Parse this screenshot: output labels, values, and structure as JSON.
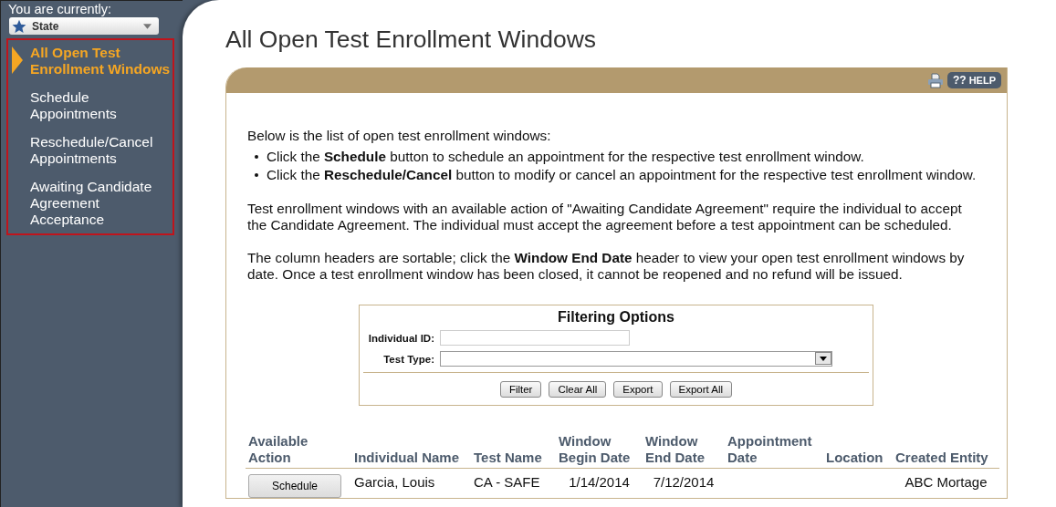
{
  "sidebar": {
    "context_label": "You are currently:",
    "context_select": {
      "value": "State"
    },
    "items": [
      {
        "label": "All Open Test Enrollment Windows",
        "selected": true
      },
      {
        "label": "Schedule Appointments",
        "selected": false
      },
      {
        "label": "Reschedule/Cancel Appointments",
        "selected": false
      },
      {
        "label": "Awaiting Candidate Agreement Acceptance",
        "selected": false
      }
    ]
  },
  "page_title": "All Open Test Enrollment Windows",
  "toolbar": {
    "help_label": "??",
    "help_text": "HELP"
  },
  "intro": "Below is the list of open test enrollment windows:",
  "bullets": [
    "Click the **Schedule** button to schedule an appointment for the respective test enrollment window.",
    "Click the **Reschedule/Cancel** button to modify or cancel an appointment for the respective test enrollment window."
  ],
  "paragraphs": [
    "Test enrollment windows with an available action of \"Awaiting Candidate Agreement\" require the individual to accept the Candidate Agreement. The individual must accept the agreement before a test appointment can be scheduled.",
    "The column headers are sortable; click the **Window End Date** header to view your open test enrollment windows by date. Once a test enrollment window has been closed, it cannot be reopened and no refund will be issued."
  ],
  "filter": {
    "title": "Filtering Options",
    "fields": [
      {
        "kind": "text",
        "label": "Individual ID:"
      },
      {
        "kind": "select",
        "label": "Test Type:"
      }
    ],
    "buttons": [
      "Filter",
      "Clear All",
      "Export",
      "Export All"
    ]
  },
  "table": {
    "columns": [
      "Available Action",
      "Individual Name",
      "Test Name",
      "Window Begin Date",
      "Window End Date",
      "Appointment Date",
      "Location",
      "Created Entity"
    ],
    "rows": [
      {
        "cells": [
          "Schedule",
          "Garcia, Louis",
          "CA - SAFE",
          "1/14/2014",
          "7/12/2014",
          "",
          "",
          "ABC Mortage"
        ]
      }
    ]
  }
}
